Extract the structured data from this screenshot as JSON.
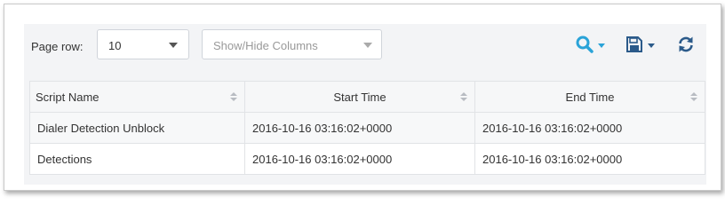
{
  "toolbar": {
    "page_row_label": "Page row:",
    "page_row_value": "10",
    "columns_placeholder": "Show/Hide Columns",
    "icons": {
      "search": "search-icon",
      "save": "save-icon",
      "refresh": "refresh-icon"
    },
    "colors": {
      "search": "#2aa3d8",
      "save": "#2b5a8a",
      "refresh": "#2b5a8a"
    }
  },
  "table": {
    "columns": [
      "Script Name",
      "Start Time",
      "End Time"
    ],
    "rows": [
      [
        "Dialer Detection Unblock",
        "2016-10-16 03:16:02+0000",
        "2016-10-16 03:16:02+0000"
      ],
      [
        "Detections",
        "2016-10-16 03:16:02+0000",
        "2016-10-16 03:16:02+0000"
      ]
    ]
  }
}
